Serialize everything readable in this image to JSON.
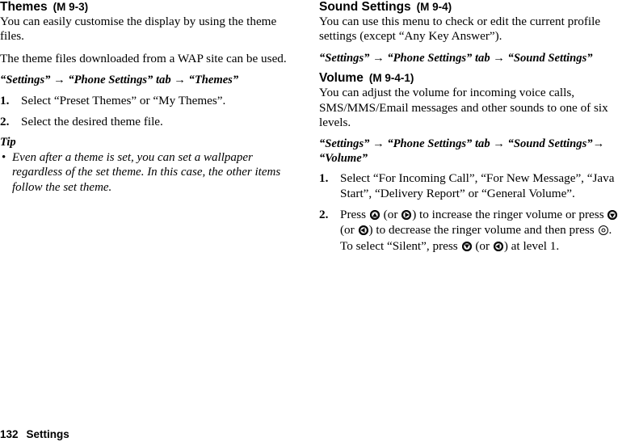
{
  "page": {
    "footer_page_number": "132",
    "footer_section": "Settings"
  },
  "left_column": {
    "section": {
      "title": "Themes",
      "menu_code": "(M 9-3)"
    },
    "paragraphs": [
      "You can easily customise the display by using the theme files.",
      "The theme files downloaded from a WAP site can be used."
    ],
    "nav_path": "“Settings” → “Phone Settings” tab → “Themes”",
    "steps": [
      {
        "number": "1.",
        "text": "Select “Preset Themes” or “My Themes”."
      },
      {
        "number": "2.",
        "text": "Select the desired theme file."
      }
    ],
    "tip": {
      "label": "Tip",
      "bullet": "•",
      "text": "Even after a theme is set, you can set a wallpaper regardless of the set theme. In this case, the other items follow the set theme."
    }
  },
  "right_column": {
    "section": {
      "title": "Sound Settings",
      "menu_code": "(M 9-4)"
    },
    "paragraph": "You can use this menu to check or edit the current profile settings (except “Any Key Answer”).",
    "nav_path": "“Settings” → “Phone Settings” tab → “Sound Settings”",
    "subsection": {
      "title": "Volume",
      "menu_code": "(M 9-4-1)",
      "paragraph": "You can adjust the volume for incoming voice calls, SMS/MMS/Email messages and other sounds to one of six levels.",
      "nav_path": "“Settings” → “Phone Settings” tab → “Sound Settings”→ “Volume”",
      "step1": {
        "number": "1.",
        "text": "Select “For Incoming Call”, “For New Message”, “Java Start”, “Delivery Report” or “General Volume”."
      },
      "step2": {
        "number": "2.",
        "part1": "Press",
        "part2": "(or",
        "part3": ") to increase the ringer volume or press",
        "part4": "(or",
        "part5": ") to decrease the ringer volume and then press",
        "part6": ".",
        "silent_part1": "To select “Silent”, press",
        "silent_part2": "(or",
        "silent_part3": ") at level 1.",
        "icons": {
          "up": "navigation-key-up-icon",
          "down": "navigation-key-down-icon",
          "left": "navigation-key-left-icon",
          "right": "navigation-key-right-icon",
          "center": "center-select-key-icon"
        }
      }
    }
  }
}
